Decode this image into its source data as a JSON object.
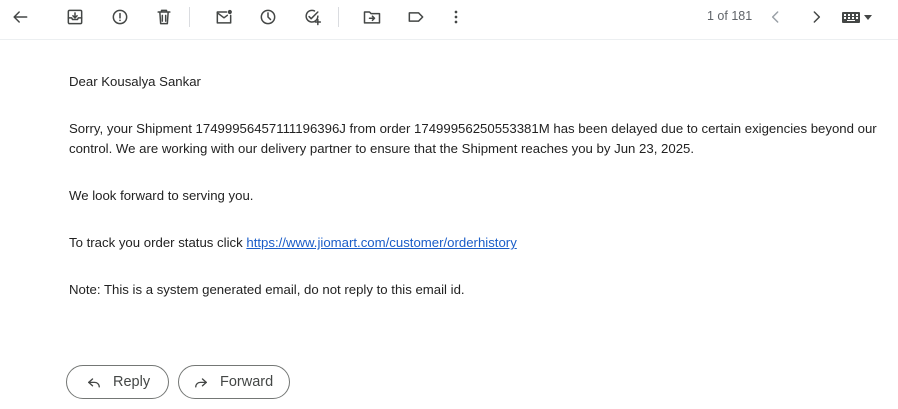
{
  "toolbar": {
    "icons": [
      "back-arrow-icon",
      "archive-icon",
      "report-spam-icon",
      "delete-icon",
      "mark-unread-icon",
      "snooze-icon",
      "add-to-tasks-icon",
      "move-to-icon",
      "label-icon",
      "more-vert-icon"
    ],
    "pager_text": "1 of 181"
  },
  "email": {
    "greeting": "Dear Kousalya Sankar",
    "para1_line1": "Sorry, your Shipment 17499956457111196396J from order 17499956250553381M has been delayed due to certain exigencies beyond our",
    "para1_line2": "control. We are working with our delivery partner to ensure that the Shipment reaches you by Jun 23, 2025.",
    "para2": "We look forward to serving you.",
    "track_prefix": "To track you order status click ",
    "track_link": "https://www.jiomart.com/customer/orderhistory",
    "note": "Note: This is a system generated email, do not reply to this email id."
  },
  "actions": {
    "reply_label": "Reply",
    "forward_label": "Forward"
  }
}
